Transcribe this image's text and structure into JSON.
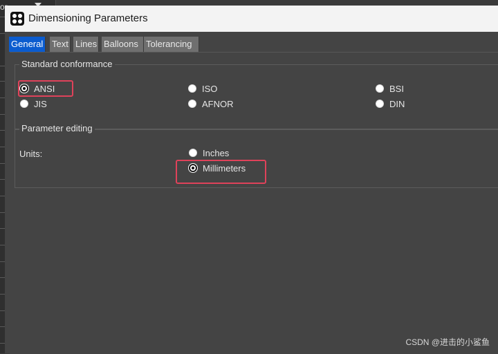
{
  "window": {
    "title": "Dimensioning Parameters"
  },
  "background": {
    "clipped_text": "or"
  },
  "tabs": [
    {
      "label": "General",
      "active": true
    },
    {
      "label": "Text",
      "active": false
    },
    {
      "label": "Lines",
      "active": false
    },
    {
      "label": "Balloons",
      "active": false
    },
    {
      "label": "Tolerancing",
      "active": false
    }
  ],
  "standard_conformance": {
    "title": "Standard conformance",
    "options": [
      {
        "label": "ANSI",
        "checked": true
      },
      {
        "label": "ISO",
        "checked": false
      },
      {
        "label": "BSI",
        "checked": false
      },
      {
        "label": "JIS",
        "checked": false
      },
      {
        "label": "AFNOR",
        "checked": false
      },
      {
        "label": "DIN",
        "checked": false
      }
    ]
  },
  "parameter_editing": {
    "title": "Parameter editing",
    "units_label": "Units:",
    "units": [
      {
        "label": "Inches",
        "checked": false
      },
      {
        "label": "Millimeters",
        "checked": true
      }
    ]
  },
  "watermark": "CSDN @进击的小鲨鱼",
  "colors": {
    "accent_tab": "#0b5ccf",
    "highlight": "#e0425a",
    "panel_bg": "#444444"
  },
  "icons": {
    "app": "app-logo-icon"
  }
}
